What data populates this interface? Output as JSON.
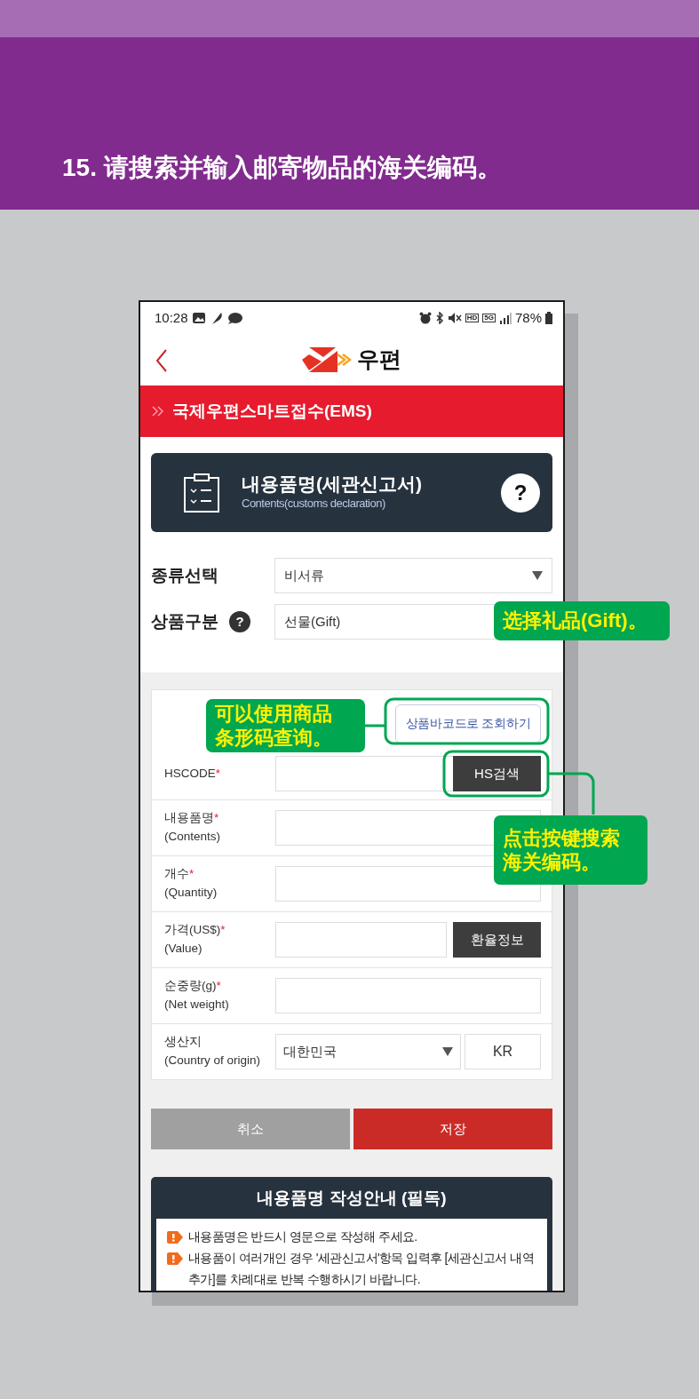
{
  "banner": {
    "title": "15. 请搜索并输入邮寄物品的海关编码。"
  },
  "phone": {
    "status_bar": {
      "time": "10:28",
      "hd": "HD",
      "network": "5G",
      "battery": "78%"
    },
    "header": {
      "logo_text": "우편"
    },
    "section_bar": {
      "title": "국제우편스마트접수(EMS)"
    },
    "info_card": {
      "title": "내용품명(세관신고서)",
      "subtitle": "Contents(customs declaration)",
      "help": "?"
    },
    "selects": [
      {
        "label": "종류선택",
        "value": "비서류",
        "kind": "dropdown"
      },
      {
        "label": "상품구분",
        "value": "선물(Gift)",
        "kind": "text",
        "help": "?"
      }
    ],
    "barcode_button": "상품바코드로 조회하기",
    "form_rows": [
      {
        "label": "HSCODE",
        "required_mark": "*",
        "kind": "input_button",
        "button": "HS검색"
      },
      {
        "label": "내용품명",
        "required_mark": "*",
        "sublabel": "(Contents)",
        "kind": "input"
      },
      {
        "label": "개수",
        "required_mark": "*",
        "sublabel": "(Quantity)",
        "kind": "input"
      },
      {
        "label": "가격(US$)",
        "required_mark": "*",
        "sublabel": "(Value)",
        "kind": "input_button",
        "button": "환율정보"
      },
      {
        "label": "순중량(g)",
        "required_mark": "*",
        "sublabel": "(Net weight)",
        "kind": "input"
      },
      {
        "label": "생산지",
        "sublabel": "(Country of origin)",
        "kind": "select_code",
        "value": "대한민국",
        "code": "KR"
      }
    ],
    "actions": [
      {
        "label": "취소",
        "kind": "cancel"
      },
      {
        "label": "저장",
        "kind": "save"
      }
    ],
    "guide": {
      "title": "내용품명 작성안내 (필독)",
      "items": [
        "내용품명은 반드시 영문으로 작성해 주세요.",
        "내용품이 여러개인 경우 '세관신고서'항목 입력후 [세관신고서 내역추가]를 차례대로 반복 수행하시기 바랍니다."
      ]
    }
  },
  "callouts": [
    {
      "lines": [
        "选择礼品(Gift)。"
      ]
    },
    {
      "lines": [
        "可以使用商品",
        "条形码查询。"
      ]
    },
    {
      "lines": [
        "点击按键搜索",
        "海关编码。"
      ]
    }
  ]
}
